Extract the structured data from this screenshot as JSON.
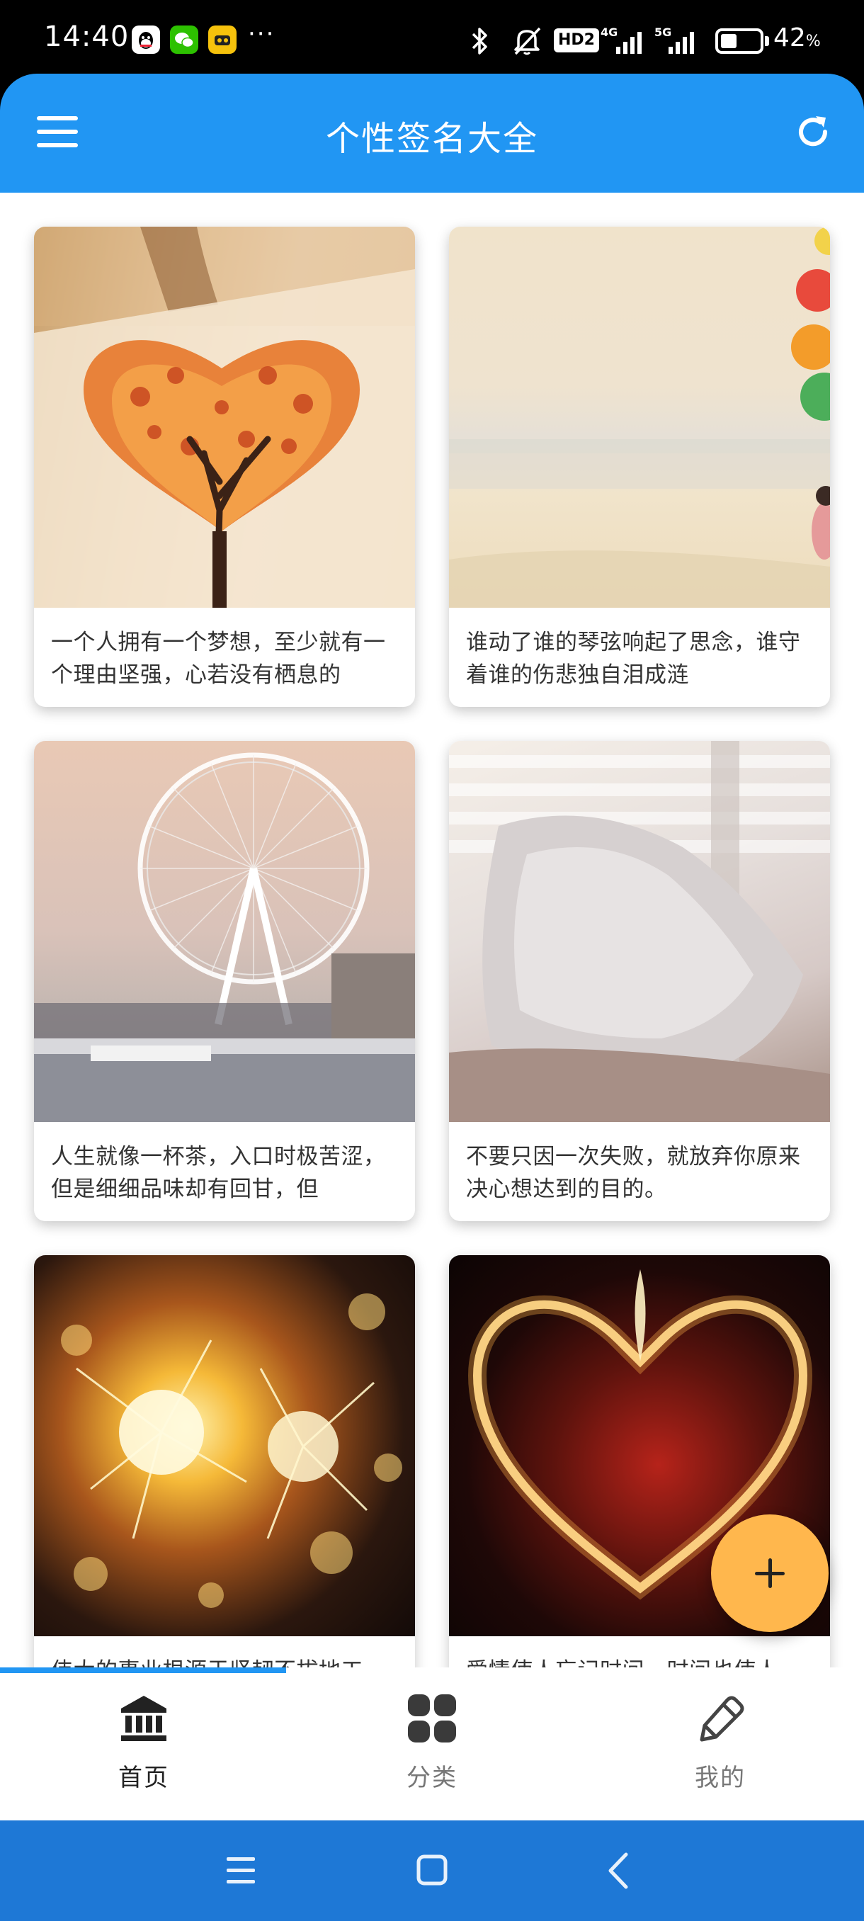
{
  "status_bar": {
    "time": "14:40",
    "more": "···",
    "hd_label": "HD2",
    "net1": "4G",
    "net2": "5G",
    "battery_level": 0.42,
    "battery_percent": "42",
    "battery_unit": "%"
  },
  "app_bar": {
    "title": "个性签名大全"
  },
  "cards": [
    {
      "text": "一个人拥有一个梦想，至少就有一个理由坚强，心若没有栖息的"
    },
    {
      "text": "谁动了谁的琴弦响起了思念，谁守着谁的伤悲独自泪成涟"
    },
    {
      "text": "人生就像一杯茶，入口时极苦涩，但是细细品味却有回甘，但"
    },
    {
      "text": "不要只因一次失败，就放弃你原来决心想达到的目的。"
    },
    {
      "text": "伟大的事业根源于坚韧不拔地工"
    },
    {
      "text": "爱情使人忘记时间，时间也使人"
    }
  ],
  "bottom_nav": {
    "items": [
      {
        "label": "首页",
        "active": true
      },
      {
        "label": "分类",
        "active": false
      },
      {
        "label": "我的",
        "active": false
      }
    ],
    "active_color": "#222222",
    "inactive_color": "#777777"
  },
  "colors": {
    "primary": "#2196f3",
    "fab": "#ffb74d",
    "system_bar": "#1e78d6"
  }
}
